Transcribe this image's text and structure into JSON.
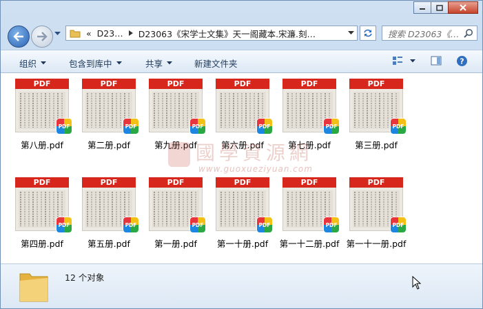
{
  "window": {
    "controls": {
      "minimize_icon": "minimize-icon",
      "maximize_icon": "maximize-icon",
      "close_icon": "close-icon"
    }
  },
  "address": {
    "overflow": "«",
    "crumbs": [
      "D23…",
      "D23063《宋学士文集》天一阁藏本.宋濂.刻…"
    ],
    "search_placeholder": "搜索 D23063《…"
  },
  "toolbar": {
    "organize": "组织",
    "include_library": "包含到库中",
    "share": "共享",
    "new_folder": "新建文件夹"
  },
  "files": [
    {
      "name": "第八册.pdf"
    },
    {
      "name": "第二册.pdf"
    },
    {
      "name": "第九册.pdf"
    },
    {
      "name": "第六册.pdf"
    },
    {
      "name": "第七册.pdf"
    },
    {
      "name": "第三册.pdf"
    },
    {
      "name": "第四册.pdf"
    },
    {
      "name": "第五册.pdf"
    },
    {
      "name": "第一册.pdf"
    },
    {
      "name": "第一十册.pdf"
    },
    {
      "name": "第一十二册.pdf"
    },
    {
      "name": "第一十一册.pdf"
    }
  ],
  "thumb": {
    "band_label": "PDF",
    "badge_label": "PDF"
  },
  "watermark": {
    "text": "國學資源網",
    "url": "www.guoxueziyuan.com"
  },
  "status": {
    "count_text": "12 个对象"
  },
  "colors": {
    "pdf_red": "#d7271c",
    "toolbar_text": "#1e395b",
    "frame": "#b9d1ea"
  }
}
